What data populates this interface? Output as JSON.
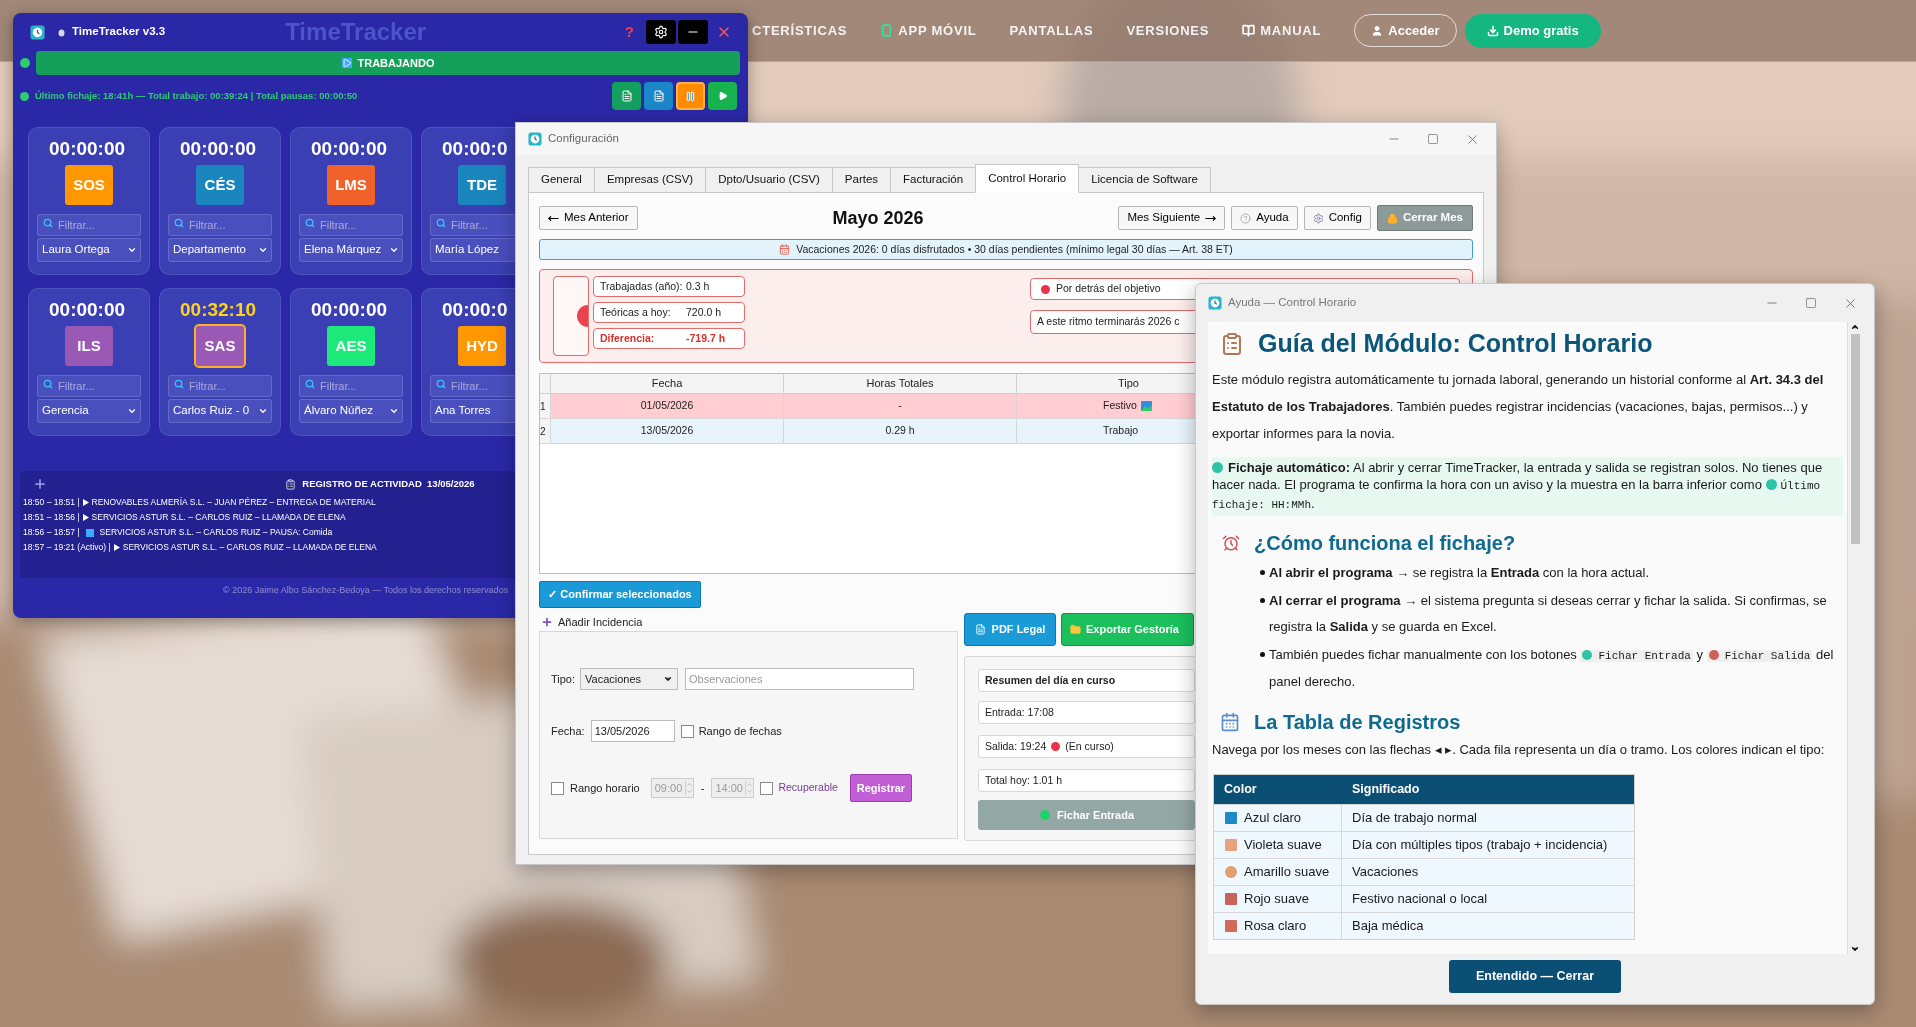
{
  "website_nav": {
    "items": [
      {
        "label": "CTERÍSTICAS",
        "kind": "plain"
      },
      {
        "label": "APP MÓVIL",
        "kind": "mobile"
      },
      {
        "label": "PANTALLAS",
        "kind": "plain"
      },
      {
        "label": "VERSIONES",
        "kind": "plain"
      },
      {
        "label": "MANUAL",
        "kind": "manual"
      }
    ],
    "login_button": "Acceder",
    "demo_button": "Demo gratis",
    "site_logo": "TimeTracker"
  },
  "tracker": {
    "title": "TimeTracker v3.3",
    "help_button": "?",
    "status": "TRABAJANDO",
    "info": "Último fichaje: 18:41h — Total trabajo: 00:39:24 | Total pausas: 00:00:50",
    "cards": [
      {
        "time": "00:00:00",
        "code": "SOS",
        "color": "#ff9800",
        "filter_placeholder": "Filtrar...",
        "person": "Laura Ortega",
        "active": false
      },
      {
        "time": "00:00:00",
        "code": "CÉS",
        "color": "#1a86bd",
        "filter_placeholder": "Filtrar...",
        "person": "Departamento",
        "active": false
      },
      {
        "time": "00:00:00",
        "code": "LMS",
        "color": "#f0622a",
        "filter_placeholder": "Filtrar...",
        "person": "Elena Márquez",
        "active": false
      },
      {
        "time": "00:00:0",
        "code": "TDE",
        "color": "#1a86bd",
        "filter_placeholder": "Filtrar...",
        "person": "María López",
        "active": false
      },
      {
        "time": "00:00:00",
        "code": "ILS",
        "color": "#9b59b6",
        "filter_placeholder": "Filtrar...",
        "person": "Gerencia",
        "active": false
      },
      {
        "time": "00:32:10",
        "code": "SAS",
        "color": "#9b59b6",
        "filter_placeholder": "Filtrar...",
        "person": "Carlos Ruiz - 0",
        "active": true
      },
      {
        "time": "00:00:00",
        "code": "AES",
        "color": "#1de97a",
        "filter_placeholder": "Filtrar...",
        "person": "Álvaro Núñez",
        "active": false
      },
      {
        "time": "00:00:0",
        "code": "HYD",
        "color": "#ff9800",
        "filter_placeholder": "Filtrar...",
        "person": "Ana Torres",
        "active": false
      }
    ],
    "log": {
      "title": "REGISTRO DE ACTIVIDAD  13/05/2026",
      "entries": [
        {
          "kind": "run",
          "time": "18:50 – 18:51 |",
          "text": "RENOVABLES ALMERÍA S.L. – JUAN PÉREZ – ENTREGA DE MATERIAL"
        },
        {
          "kind": "run",
          "time": "18:51 – 18:56 |",
          "text": "SERVICIOS ASTUR S.L. – CARLOS RUIZ – LLAMADA DE ELENA"
        },
        {
          "kind": "pause",
          "time": "18:56 – 18:57 |",
          "text": "SERVICIOS ASTUR S.L. – CARLOS RUIZ – PAUSA: Comida"
        },
        {
          "kind": "run",
          "time": "18:57 – 19:21 (Activo) |",
          "text": "SERVICIOS ASTUR S.L. – CARLOS RUIZ – LLAMADA DE ELENA"
        }
      ]
    },
    "footer": "© 2026 Jaime Albo Sánchez-Bedoya — Todos los derechos reservados"
  },
  "config": {
    "title": "Configuración",
    "tabs": [
      {
        "label": "General",
        "selected": false
      },
      {
        "label": "Empresas (CSV)",
        "selected": false
      },
      {
        "label": "Dpto/Usuario (CSV)",
        "selected": false
      },
      {
        "label": "Partes",
        "selected": false
      },
      {
        "label": "Facturación",
        "selected": false
      },
      {
        "label": "Control Horario",
        "selected": true
      },
      {
        "label": "Licencia de Software",
        "selected": false
      }
    ],
    "prev_button": "Mes Anterior",
    "month": "Mayo 2026",
    "next_button": "Mes Siguiente",
    "help_button": "Ayuda",
    "config_button": "Config",
    "close_month_button": "Cerrar Mes",
    "vacation_banner": "Vacaciones 2026: 0 días disfrutados • 30 días pendientes (mínimo legal 30 días — Art. 38 ET)",
    "stats": [
      {
        "label": "Trabajadas (año):",
        "value": "0.3 h",
        "highlight": false
      },
      {
        "label": "Teóricas a hoy:",
        "value": "720.0 h",
        "highlight": false
      },
      {
        "label": "Diferencia:",
        "value": "-719.7 h",
        "highlight": true
      }
    ],
    "objective_status": "Por detrás del objetivo",
    "projection": "A este ritmo terminarás 2026 c",
    "table": {
      "columns": [
        "Fecha",
        "Horas Totales",
        "Tipo"
      ],
      "rows": [
        {
          "number": "1",
          "date": "01/05/2026",
          "hours": "-",
          "type": "Festivo",
          "kind": "holiday",
          "color": "#ffcdd2"
        },
        {
          "number": "2",
          "date": "13/05/2026",
          "hours": "0.29 h",
          "type": "Trabajo",
          "kind": "work",
          "color": "#e8f4fc"
        }
      ]
    },
    "confirm_button": "✓ Confirmar seleccionados",
    "incidence": {
      "title": "Añadir Incidencia",
      "type_label": "Tipo:",
      "type_value": "Vacaciones",
      "notes_placeholder": "Observaciones",
      "date_label": "Fecha:",
      "date_value": "13/05/2026",
      "date_range": {
        "label": "Rango de fechas",
        "checked": false
      },
      "time_range": {
        "label": "Rango horario",
        "checked": false
      },
      "from": "09:00",
      "separator": "-",
      "to": "14:00",
      "recoverable": {
        "label": "Recuperable",
        "checked": false
      },
      "register_button": "Registrar"
    },
    "pdf_button": "PDF Legal",
    "export_button": "Exportar Gestoría",
    "summary": {
      "title": "Resumen del día en curso",
      "entry": "Entrada: 17:08",
      "exit": "Salida: 19:24",
      "exit_note": "(En curso)",
      "total": "Total hoy: 1.01 h",
      "clock_button": "Fichar Entrada"
    }
  },
  "help": {
    "title": "Ayuda — Control Horario",
    "heading": "Guía del Módulo: Control Horario",
    "intro": "Este módulo registra automáticamente tu jornada laboral, generando un historial conforme al **Art. 34.3 del Estatuto de los Trabajadores**. También puedes registrar incidencias (vacaciones, bajas, permisos...) y exportar informes para la novia.",
    "note": {
      "text": "**Fichaje automático:** Al abrir y cerrar TimeTracker, la entrada y salida se registran solos. No tienes que hacer nada. El programa te confirma la hora con un aviso y la muestra en la barra inferior como",
      "code": "Último fichaje: HH:MMh",
      "tail": "."
    },
    "section_1": "¿Cómo funciona el fichaje?",
    "bullets": [
      {
        "parts": [
          {
            "kind": "text",
            "text": "**Al abrir el programa** → se registra la **Entrada** con la hora actual."
          }
        ]
      },
      {
        "parts": [
          {
            "kind": "text",
            "text": "**Al cerrar el programa** → el sistema pregunta si deseas cerrar y fichar la salida. Si confirmas, se registra la **Salida** y se guarda en Excel."
          }
        ]
      },
      {
        "parts": [
          {
            "kind": "text",
            "text": "También puedes fichar manualmente con los botones"
          },
          {
            "kind": "code",
            "text": "Fichar Entrada",
            "color": "#2ec4a6"
          },
          {
            "kind": "text",
            "text": "y"
          },
          {
            "kind": "code",
            "text": "Fichar Salida",
            "color": "#d0605a"
          },
          {
            "kind": "text",
            "text": "del panel derecho."
          }
        ]
      }
    ],
    "section_2": "La Tabla de Registros",
    "table_intro": "Navega por los meses con las flechas ◂ ▸. Cada fila representa un día o tramo. Los colores indican el tipo:",
    "legend": {
      "columns": [
        "Color",
        "Significado"
      ],
      "rows": [
        {
          "name": "Azul claro",
          "meaning": "Día de trabajo normal",
          "color": "#1e88c8",
          "kind": "square"
        },
        {
          "name": "Violeta suave",
          "meaning": "Día con múltiples tipos (trabajo + incidencia)",
          "color": "#e8a27e",
          "kind": "square"
        },
        {
          "name": "Amarillo suave",
          "meaning": "Vacaciones",
          "color": "#e0a070",
          "kind": "circle"
        },
        {
          "name": "Rojo suave",
          "meaning": "Festivo nacional o local",
          "color": "#c86458",
          "kind": "square"
        },
        {
          "name": "Rosa claro",
          "meaning": "Baja médica",
          "color": "#d06a5a",
          "kind": "square"
        }
      ]
    },
    "ok_button": "Entendido — Cerrar"
  }
}
